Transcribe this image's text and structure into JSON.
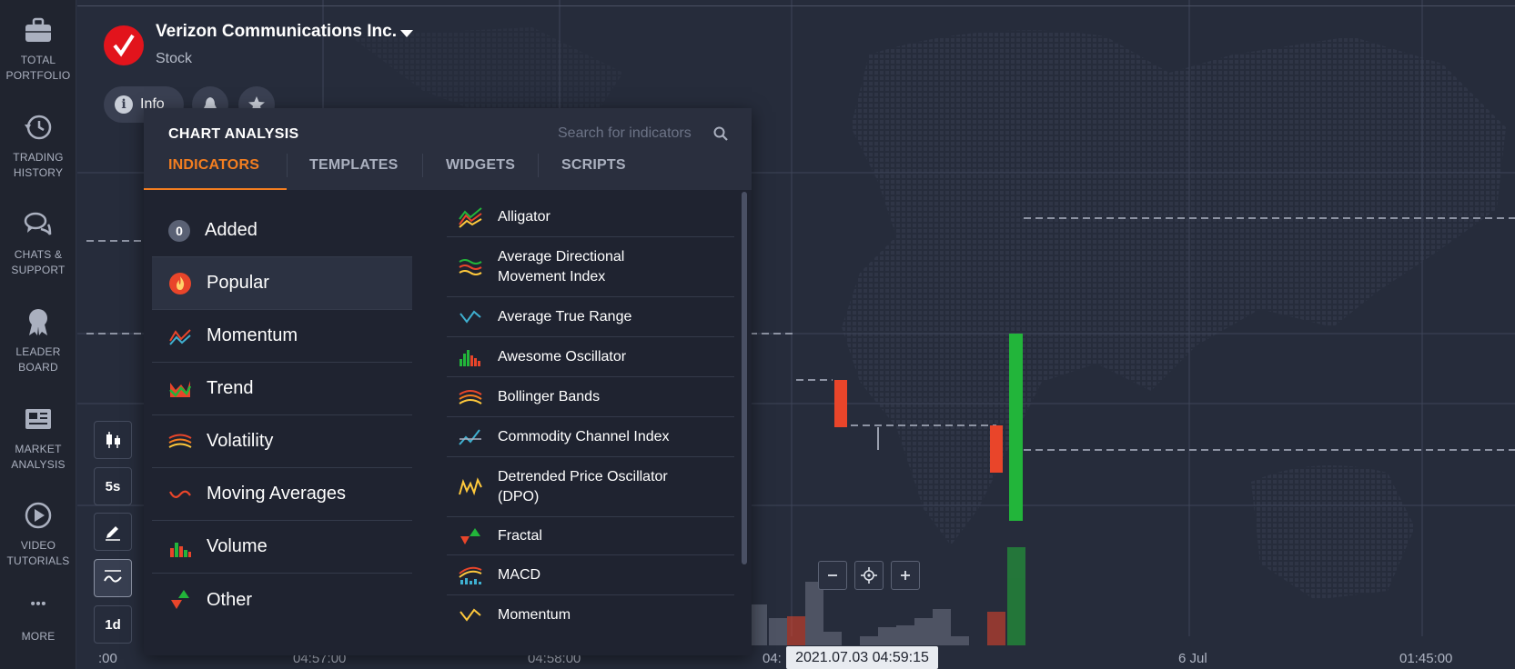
{
  "sidebar": {
    "items": [
      {
        "label": "TOTAL\nPORTFOLIO",
        "icon": "briefcase-icon"
      },
      {
        "label": "TRADING\nHISTORY",
        "icon": "history-icon"
      },
      {
        "label": "CHATS &\nSUPPORT",
        "icon": "chat-icon"
      },
      {
        "label": "LEADER\nBOARD",
        "icon": "award-icon"
      },
      {
        "label": "MARKET\nANALYSIS",
        "icon": "newspaper-icon"
      },
      {
        "label": "VIDEO\nTUTORIALS",
        "icon": "play-icon"
      },
      {
        "label": "MORE",
        "icon": "more-icon"
      }
    ]
  },
  "asset": {
    "name": "Verizon Communications Inc.",
    "type": "Stock",
    "info_label": "Info"
  },
  "tools": {
    "timeframe": "5s",
    "period": "1d"
  },
  "chart": {
    "time_labels": [
      "04:57:00",
      "04:58:00",
      "04:",
      "6 Jul",
      "01:45:00",
      ":00"
    ],
    "cursor_time": "2021.07.03 04:59:15",
    "candle_up_color": "#22b53a",
    "candle_down_color": "#e9452a"
  },
  "panel": {
    "title": "CHART ANALYSIS",
    "search_placeholder": "Search for indicators",
    "tabs": [
      "INDICATORS",
      "TEMPLATES",
      "WIDGETS",
      "SCRIPTS"
    ],
    "active_tab": "INDICATORS",
    "accent_color": "#f47e20",
    "added_count": "0",
    "categories": [
      {
        "label": "Added",
        "icon": "count-badge"
      },
      {
        "label": "Popular",
        "icon": "fire-icon"
      },
      {
        "label": "Momentum",
        "icon": "momentum-icon"
      },
      {
        "label": "Trend",
        "icon": "trend-icon"
      },
      {
        "label": "Volatility",
        "icon": "volatility-icon"
      },
      {
        "label": "Moving Averages",
        "icon": "moving-average-icon"
      },
      {
        "label": "Volume",
        "icon": "volume-icon"
      },
      {
        "label": "Other",
        "icon": "other-icon"
      }
    ],
    "active_category": "Popular",
    "indicators": [
      {
        "label": "Alligator",
        "icon": "alligator-icon"
      },
      {
        "label": "Average Directional\nMovement Index",
        "icon": "adx-icon"
      },
      {
        "label": "Average True Range",
        "icon": "atr-icon"
      },
      {
        "label": "Awesome Oscillator",
        "icon": "awesome-oscillator-icon"
      },
      {
        "label": "Bollinger Bands",
        "icon": "bollinger-icon"
      },
      {
        "label": "Commodity Channel Index",
        "icon": "cci-icon"
      },
      {
        "label": "Detrended Price Oscillator\n(DPO)",
        "icon": "dpo-icon"
      },
      {
        "label": "Fractal",
        "icon": "fractal-icon"
      },
      {
        "label": "MACD",
        "icon": "macd-icon"
      },
      {
        "label": "Momentum",
        "icon": "momentum-indicator-icon"
      }
    ]
  }
}
